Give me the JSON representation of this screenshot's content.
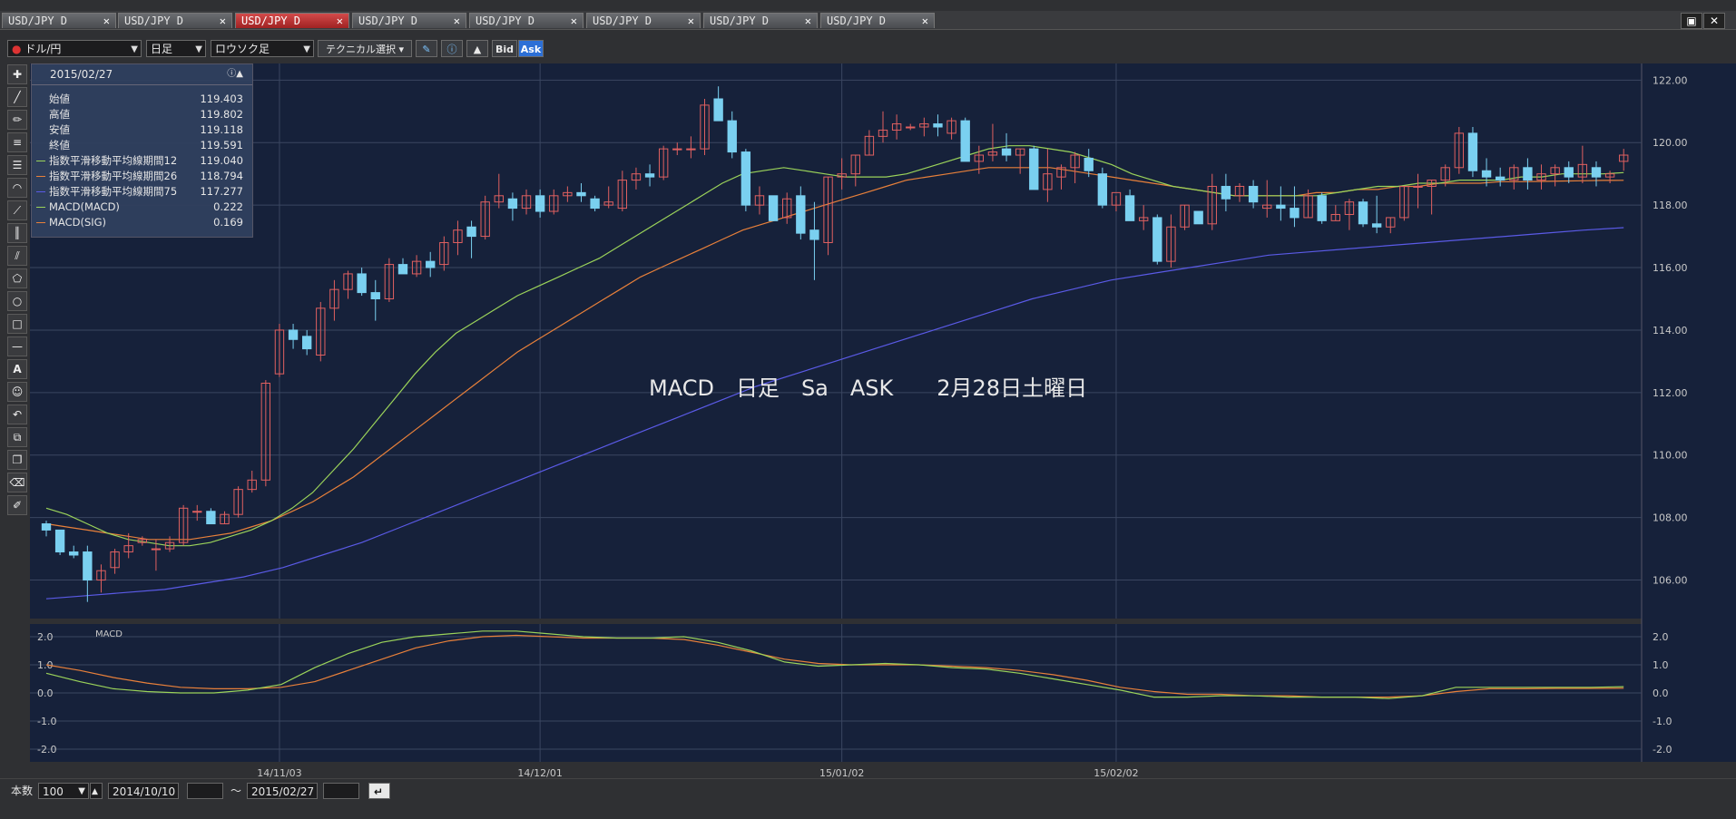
{
  "tabs": [
    {
      "label": "USD/JPY D",
      "active": false
    },
    {
      "label": "USD/JPY D",
      "active": false
    },
    {
      "label": "USD/JPY D",
      "active": true
    },
    {
      "label": "USD/JPY D",
      "active": false
    },
    {
      "label": "USD/JPY D",
      "active": false
    },
    {
      "label": "USD/JPY D",
      "active": false
    },
    {
      "label": "USD/JPY D",
      "active": false
    },
    {
      "label": "USD/JPY D",
      "active": false
    }
  ],
  "toolbar": {
    "symbol": "ドル/円",
    "period": "日足",
    "chart_style": "ロウソク足",
    "technical": "テクニカル選択",
    "bid": "Bid",
    "ask": "Ask"
  },
  "info": {
    "date": "2015/02/27",
    "rows": [
      {
        "label": "始値",
        "value": "119.403",
        "color": ""
      },
      {
        "label": "高値",
        "value": "119.802",
        "color": ""
      },
      {
        "label": "安値",
        "value": "119.118",
        "color": ""
      },
      {
        "label": "終値",
        "value": "119.591",
        "color": ""
      },
      {
        "label": "指数平滑移動平均線期間12",
        "value": "119.040",
        "color": "#9bd35a"
      },
      {
        "label": "指数平滑移動平均線期間26",
        "value": "118.794",
        "color": "#e8803a"
      },
      {
        "label": "指数平滑移動平均線期間75",
        "value": "117.277",
        "color": "#5a5ae6"
      },
      {
        "label": "MACD(MACD)",
        "value": "0.222",
        "color": "#9bd35a"
      },
      {
        "label": "MACD(SIG)",
        "value": "0.169",
        "color": "#e8803a"
      }
    ]
  },
  "annotation": "MACD　日足　Sa　ASK　　2月28日土曜日",
  "bottom": {
    "count_label": "本数",
    "count_value": "100",
    "from_date": "2014/10/10",
    "tilde": "〜",
    "to_date": "2015/02/27"
  },
  "colors": {
    "background": "#16213a",
    "up_candle": "#e06060",
    "down_candle": "#7ad0f0",
    "ema12": "#9bd35a",
    "ema26": "#e8803a",
    "ema75": "#5a5ae6",
    "macd": "#9bd35a",
    "signal": "#e8803a",
    "grid": "#3a4660",
    "axis_text": "#c8c8c8"
  },
  "chart_data": [
    {
      "type": "candlestick",
      "title": "",
      "ylim": [
        105.0,
        122.3
      ],
      "y_ticks": [
        "106.00",
        "108.00",
        "110.00",
        "112.00",
        "114.00",
        "116.00",
        "118.00",
        "120.00",
        "122.00"
      ],
      "x_tick_labels": [
        "14/11/03",
        "14/12/01",
        "15/01/02",
        "15/02/02"
      ],
      "x_tick_index": [
        17,
        36,
        58,
        78
      ],
      "grid": true,
      "candles": [
        [
          107.8,
          107.9,
          107.4,
          107.6
        ],
        [
          107.6,
          107.6,
          106.8,
          106.9
        ],
        [
          106.9,
          107.1,
          106.7,
          106.8
        ],
        [
          106.9,
          107.1,
          105.3,
          106.0
        ],
        [
          106.0,
          106.5,
          105.6,
          106.3
        ],
        [
          106.4,
          107.0,
          106.2,
          106.9
        ],
        [
          106.9,
          107.5,
          106.7,
          107.1
        ],
        [
          107.2,
          107.4,
          107.1,
          107.3
        ],
        [
          107.0,
          107.3,
          106.3,
          107.0
        ],
        [
          107.0,
          107.4,
          106.9,
          107.2
        ],
        [
          107.2,
          108.4,
          107.1,
          108.3
        ],
        [
          108.2,
          108.4,
          107.9,
          108.2
        ],
        [
          108.2,
          108.3,
          107.8,
          107.8
        ],
        [
          107.8,
          108.2,
          107.8,
          108.1
        ],
        [
          108.1,
          109.0,
          108.0,
          108.9
        ],
        [
          108.9,
          109.5,
          108.8,
          109.2
        ],
        [
          109.2,
          112.4,
          109.0,
          112.3
        ],
        [
          112.6,
          114.2,
          112.5,
          114.0
        ],
        [
          114.0,
          114.2,
          113.4,
          113.7
        ],
        [
          113.8,
          114.0,
          113.2,
          113.4
        ],
        [
          113.2,
          114.9,
          113.0,
          114.7
        ],
        [
          114.7,
          115.6,
          114.3,
          115.3
        ],
        [
          115.3,
          115.9,
          115.0,
          115.8
        ],
        [
          115.8,
          116.0,
          115.1,
          115.2
        ],
        [
          115.2,
          115.6,
          114.3,
          115.0
        ],
        [
          115.0,
          116.3,
          114.9,
          116.1
        ],
        [
          116.1,
          116.3,
          115.8,
          115.8
        ],
        [
          115.8,
          116.4,
          115.7,
          116.2
        ],
        [
          116.2,
          116.5,
          115.7,
          116.0
        ],
        [
          116.1,
          117.0,
          115.9,
          116.8
        ],
        [
          116.8,
          117.5,
          116.4,
          117.2
        ],
        [
          117.3,
          117.5,
          116.3,
          117.0
        ],
        [
          117.0,
          118.3,
          116.9,
          118.1
        ],
        [
          118.1,
          119.0,
          117.9,
          118.3
        ],
        [
          118.2,
          118.4,
          117.5,
          117.9
        ],
        [
          117.9,
          118.5,
          117.7,
          118.3
        ],
        [
          118.3,
          118.5,
          117.6,
          117.8
        ],
        [
          117.8,
          118.5,
          117.7,
          118.3
        ],
        [
          118.3,
          118.6,
          118.1,
          118.4
        ],
        [
          118.4,
          118.7,
          118.1,
          118.3
        ],
        [
          118.2,
          118.3,
          117.8,
          117.9
        ],
        [
          118.0,
          118.6,
          117.9,
          118.1
        ],
        [
          117.9,
          119.1,
          117.8,
          118.8
        ],
        [
          118.8,
          119.2,
          118.5,
          119.0
        ],
        [
          119.0,
          119.3,
          118.6,
          118.9
        ],
        [
          118.9,
          119.9,
          118.8,
          119.8
        ],
        [
          119.8,
          120.0,
          119.6,
          119.8
        ],
        [
          119.8,
          120.2,
          119.5,
          119.8
        ],
        [
          119.8,
          121.4,
          119.6,
          121.2
        ],
        [
          121.4,
          121.8,
          120.7,
          120.7
        ],
        [
          120.7,
          121.0,
          119.5,
          119.7
        ],
        [
          119.7,
          119.8,
          117.8,
          118.0
        ],
        [
          118.0,
          118.6,
          117.7,
          118.3
        ],
        [
          118.3,
          118.3,
          117.6,
          117.5
        ],
        [
          117.6,
          118.4,
          117.4,
          118.2
        ],
        [
          118.3,
          118.6,
          116.9,
          117.1
        ],
        [
          117.2,
          118.1,
          115.6,
          116.9
        ],
        [
          116.8,
          118.9,
          116.4,
          118.9
        ],
        [
          118.9,
          119.5,
          118.5,
          119.0
        ],
        [
          119.0,
          119.6,
          118.6,
          119.6
        ],
        [
          119.6,
          120.4,
          119.6,
          120.2
        ],
        [
          120.2,
          121.0,
          120.0,
          120.4
        ],
        [
          120.4,
          120.9,
          120.1,
          120.6
        ],
        [
          120.5,
          120.6,
          120.4,
          120.5
        ],
        [
          120.5,
          120.8,
          120.2,
          120.6
        ],
        [
          120.6,
          120.9,
          120.2,
          120.5
        ],
        [
          120.3,
          120.8,
          120.1,
          120.7
        ],
        [
          120.7,
          120.8,
          119.9,
          119.4
        ],
        [
          119.4,
          119.9,
          119.0,
          119.6
        ],
        [
          119.6,
          120.6,
          119.4,
          119.7
        ],
        [
          119.8,
          120.3,
          119.4,
          119.6
        ],
        [
          119.6,
          119.8,
          119.0,
          119.8
        ],
        [
          119.8,
          119.9,
          119.0,
          118.5
        ],
        [
          118.5,
          119.8,
          118.1,
          119.0
        ],
        [
          118.9,
          119.3,
          118.5,
          119.2
        ],
        [
          119.2,
          119.7,
          118.7,
          119.6
        ],
        [
          119.5,
          119.8,
          118.9,
          119.1
        ],
        [
          119.0,
          119.2,
          117.9,
          118.0
        ],
        [
          118.0,
          118.3,
          117.8,
          118.4
        ],
        [
          118.3,
          118.5,
          117.5,
          117.5
        ],
        [
          117.5,
          118.0,
          117.2,
          117.6
        ],
        [
          117.6,
          117.7,
          116.1,
          116.2
        ],
        [
          116.2,
          117.7,
          116.0,
          117.3
        ],
        [
          117.3,
          118.0,
          117.2,
          118.0
        ],
        [
          117.8,
          117.8,
          117.4,
          117.4
        ],
        [
          117.4,
          119.0,
          117.2,
          118.6
        ],
        [
          118.6,
          119.0,
          117.8,
          118.2
        ],
        [
          118.3,
          118.7,
          118.1,
          118.6
        ],
        [
          118.6,
          118.8,
          117.9,
          118.1
        ],
        [
          117.9,
          118.8,
          117.6,
          118.0
        ],
        [
          118.0,
          118.6,
          117.5,
          117.9
        ],
        [
          117.9,
          118.6,
          117.3,
          117.6
        ],
        [
          117.6,
          118.5,
          117.6,
          118.3
        ],
        [
          118.3,
          118.4,
          117.4,
          117.5
        ],
        [
          117.5,
          118.0,
          117.5,
          117.7
        ],
        [
          117.7,
          118.2,
          117.2,
          118.1
        ],
        [
          118.1,
          118.2,
          117.3,
          117.4
        ],
        [
          117.4,
          118.3,
          117.1,
          117.3
        ],
        [
          117.3,
          117.6,
          117.1,
          117.6
        ],
        [
          117.6,
          118.6,
          117.5,
          118.6
        ],
        [
          118.6,
          119.0,
          117.9,
          118.6
        ],
        [
          118.6,
          118.8,
          117.7,
          118.8
        ],
        [
          118.8,
          119.3,
          118.6,
          119.2
        ],
        [
          119.2,
          120.5,
          119.0,
          120.3
        ],
        [
          120.3,
          120.5,
          118.9,
          119.1
        ],
        [
          119.1,
          119.5,
          118.6,
          118.9
        ],
        [
          118.9,
          119.2,
          118.6,
          118.8
        ],
        [
          118.8,
          119.3,
          118.5,
          119.2
        ],
        [
          119.2,
          119.5,
          118.5,
          118.8
        ],
        [
          118.8,
          119.3,
          118.5,
          119.0
        ],
        [
          119.0,
          119.3,
          118.6,
          119.2
        ],
        [
          119.2,
          119.4,
          118.7,
          118.9
        ],
        [
          118.9,
          119.9,
          118.7,
          119.3
        ],
        [
          119.2,
          119.4,
          118.6,
          118.9
        ],
        [
          118.9,
          119.1,
          118.7,
          119.0
        ],
        [
          119.4,
          119.8,
          119.1,
          119.6
        ]
      ],
      "series": [
        {
          "name": "指数平滑移動平均線期間12",
          "values": [
            108.3,
            108.1,
            107.8,
            107.5,
            107.3,
            107.2,
            107.1,
            107.1,
            107.2,
            107.4,
            107.6,
            107.9,
            108.3,
            108.8,
            109.5,
            110.2,
            111.0,
            111.8,
            112.6,
            113.3,
            113.9,
            114.3,
            114.7,
            115.1,
            115.4,
            115.7,
            116.0,
            116.3,
            116.7,
            117.1,
            117.5,
            117.9,
            118.3,
            118.7,
            119.0,
            119.1,
            119.2,
            119.1,
            119.0,
            118.9,
            118.9,
            118.9,
            119.0,
            119.2,
            119.4,
            119.6,
            119.8,
            119.9,
            119.9,
            119.8,
            119.7,
            119.5,
            119.3,
            119.0,
            118.8,
            118.6,
            118.5,
            118.4,
            118.3,
            118.3,
            118.3,
            118.3,
            118.3,
            118.4,
            118.5,
            118.6,
            118.6,
            118.7,
            118.7,
            118.8,
            118.8,
            118.8,
            118.9,
            118.9,
            119.0,
            119.0,
            119.0,
            119.04
          ]
        },
        {
          "name": "指数平滑移動平均線期間26",
          "values": [
            107.8,
            107.7,
            107.6,
            107.5,
            107.4,
            107.3,
            107.3,
            107.3,
            107.4,
            107.5,
            107.7,
            107.9,
            108.2,
            108.5,
            108.9,
            109.3,
            109.8,
            110.3,
            110.8,
            111.3,
            111.8,
            112.3,
            112.8,
            113.3,
            113.7,
            114.1,
            114.5,
            114.9,
            115.3,
            115.7,
            116.0,
            116.3,
            116.6,
            116.9,
            117.2,
            117.4,
            117.6,
            117.8,
            118.0,
            118.2,
            118.4,
            118.6,
            118.8,
            118.9,
            119.0,
            119.1,
            119.2,
            119.2,
            119.2,
            119.2,
            119.1,
            119.0,
            118.9,
            118.8,
            118.7,
            118.6,
            118.5,
            118.4,
            118.3,
            118.3,
            118.3,
            118.3,
            118.4,
            118.4,
            118.5,
            118.5,
            118.6,
            118.6,
            118.7,
            118.7,
            118.7,
            118.75,
            118.75,
            118.76,
            118.77,
            118.78,
            118.79,
            118.794
          ]
        },
        {
          "name": "指数平滑移動平均線期間75",
          "values": [
            105.4,
            105.5,
            105.6,
            105.7,
            105.9,
            106.1,
            106.4,
            106.8,
            107.2,
            107.7,
            108.2,
            108.7,
            109.2,
            109.7,
            110.2,
            110.7,
            111.2,
            111.7,
            112.2,
            112.6,
            113.0,
            113.4,
            113.8,
            114.2,
            114.6,
            115.0,
            115.3,
            115.6,
            115.8,
            116.0,
            116.2,
            116.4,
            116.5,
            116.6,
            116.7,
            116.8,
            116.9,
            117.0,
            117.1,
            117.2,
            117.277
          ]
        },
        {
          "name": "MACD(MACD)",
          "values": [
            0.7,
            0.4,
            0.15,
            0.05,
            0.0,
            0.0,
            0.1,
            0.3,
            0.9,
            1.4,
            1.8,
            2.0,
            2.1,
            2.2,
            2.2,
            2.1,
            2.0,
            1.95,
            1.95,
            2.0,
            1.8,
            1.5,
            1.1,
            0.95,
            1.0,
            1.05,
            1.0,
            0.9,
            0.85,
            0.7,
            0.5,
            0.3,
            0.1,
            -0.15,
            -0.15,
            -0.1,
            -0.1,
            -0.15,
            -0.15,
            -0.15,
            -0.2,
            -0.1,
            0.2,
            0.2,
            0.2,
            0.2,
            0.2,
            0.222
          ]
        },
        {
          "name": "MACD(SIG)",
          "values": [
            1.0,
            0.8,
            0.55,
            0.35,
            0.2,
            0.15,
            0.15,
            0.2,
            0.4,
            0.8,
            1.2,
            1.6,
            1.85,
            2.0,
            2.05,
            2.0,
            1.95,
            1.95,
            1.95,
            1.9,
            1.7,
            1.45,
            1.2,
            1.05,
            1.0,
            1.0,
            1.0,
            0.95,
            0.9,
            0.8,
            0.65,
            0.45,
            0.2,
            0.05,
            -0.05,
            -0.05,
            -0.1,
            -0.1,
            -0.15,
            -0.15,
            -0.15,
            -0.1,
            0.05,
            0.15,
            0.15,
            0.16,
            0.16,
            0.169
          ]
        }
      ]
    },
    {
      "type": "line",
      "title": "MACD",
      "ylim": [
        -2.0,
        2.0
      ],
      "y_ticks": [
        "2.0",
        "1.0",
        "0.0",
        "-1.0",
        "-2.0"
      ]
    }
  ]
}
